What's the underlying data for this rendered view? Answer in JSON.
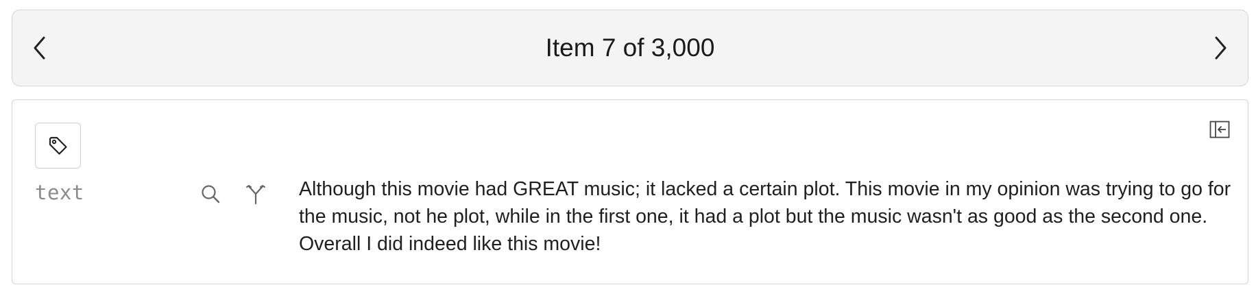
{
  "navigation": {
    "title": "Item 7 of 3,000",
    "prev_icon": "chevron-left-icon",
    "next_icon": "chevron-right-icon"
  },
  "record": {
    "tag_icon": "tag-icon",
    "collapse_icon": "sidebar-collapse-icon",
    "field": {
      "name": "text",
      "actions": [
        "search-icon",
        "fork-icon"
      ],
      "value": "Although this movie had GREAT music; it lacked a certain plot. This movie in my opinion was trying to go for the music, not he plot, while in the first one, it had a plot but the music wasn't as good as the second one. Overall I did indeed like this movie!"
    }
  },
  "colors": {
    "nav_background": "#f4f4f4",
    "border": "#d4d4d4",
    "muted_text": "#8a8a8a",
    "text": "#1f1f1f"
  }
}
